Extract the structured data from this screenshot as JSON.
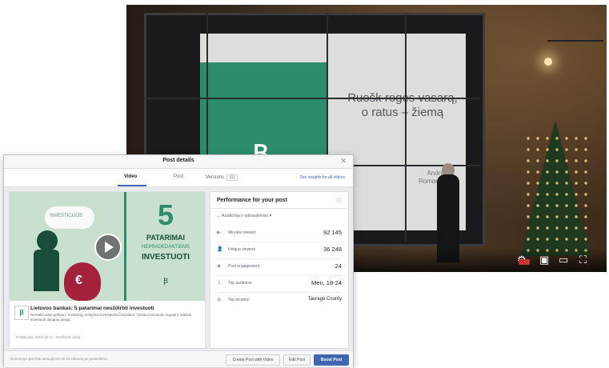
{
  "video": {
    "slide_title": "Ruošk roges vasarą, o ratus – žiemą",
    "slide_logo": "Ꞵ",
    "slide_sub": "Andrius Romanovskis",
    "controls": {
      "settings_icon": "gear-icon",
      "miniplayer_icon": "miniplayer-icon",
      "theater_icon": "theater-icon",
      "fullscreen_icon": "fullscreen-icon"
    }
  },
  "dialog": {
    "title": "Post details",
    "close_icon": "close-icon",
    "tabs": [
      {
        "label": "Video",
        "active": true
      },
      {
        "label": "Post",
        "active": false
      },
      {
        "label": "Versions",
        "badge": "(1)",
        "active": false
      }
    ],
    "header_link": "See insights for all videos",
    "post": {
      "thumbnail": {
        "bubble": "INVESTICIJOS",
        "number": "5",
        "line1": "PATARIMAI",
        "line2": "NEPRADEDANTIEMS",
        "line3": "INVESTUOTI",
        "brand": "Ꞵ",
        "bag_symbol": "€"
      },
      "avatar": "Ꞵ",
      "title": "Lietuvos bankas: 5 patarimai neuždirbti investuoti",
      "description": "Nerealizuotas pelnas ir investicijų mokymai investavimui tematika. Geriau investuoti, taupyti ir laikinai investuoti daugiau pinigų.",
      "meta": "Publikuota: 2019-12-11 · Peržiūrėti įrašą"
    },
    "performance": {
      "title": "Performance for your post",
      "filter": "Auditorija ir įsitraukimas",
      "rows": [
        {
          "icon": "▶",
          "label": "Minutes viewed",
          "value": "92 145"
        },
        {
          "icon": "👤",
          "label": "Unique viewers",
          "value": "36 248"
        },
        {
          "icon": "◉",
          "label": "Post engagement",
          "value": "24"
        },
        {
          "icon": "♙",
          "label": "Top audience",
          "value": "Men, 18-24"
        },
        {
          "icon": "◍",
          "label": "Top location",
          "value": "Tauragė County"
        }
      ]
    },
    "footer": {
      "note": "Duomenys gali būti atnaujinami iki 24 valandų po paskelbimo",
      "buttons": [
        "Create Post with Video",
        "Edit Post",
        "Boost Post"
      ]
    }
  }
}
